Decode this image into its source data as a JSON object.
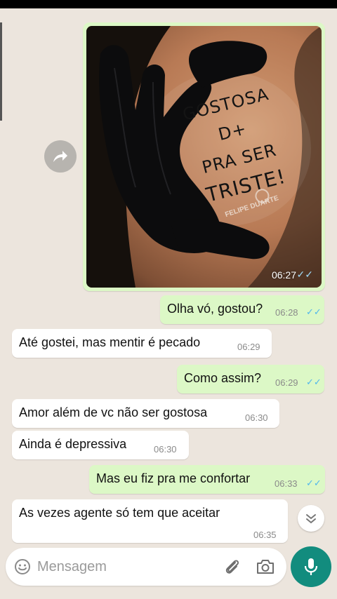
{
  "image_message": {
    "tattoo_text": [
      "GOSTOSA D+",
      "PRA SER",
      "TRISTE!"
    ],
    "watermark": "FELIPE DUARTE",
    "time": "06:27",
    "read_receipt": "double-check-read"
  },
  "messages": [
    {
      "direction": "out",
      "text": "Olha vó, gostou?",
      "time": "06:28"
    },
    {
      "direction": "in",
      "text": "Até gostei, mas mentir é pecado",
      "time": "06:29"
    },
    {
      "direction": "out",
      "text": "Como assim?",
      "time": "06:29"
    },
    {
      "direction": "in",
      "text": "Amor além de vc não ser gostosa",
      "time": "06:30"
    },
    {
      "direction": "in",
      "text": "Ainda é depressiva",
      "time": "06:30"
    },
    {
      "direction": "out",
      "text": "Mas eu fiz pra me confortar",
      "time": "06:33"
    },
    {
      "direction": "in",
      "text": "As vezes agente só tem que aceitar",
      "time": "06:35"
    }
  ],
  "input": {
    "placeholder": "Mensagem"
  },
  "icons": {
    "forward": "forward-icon",
    "emoji": "emoji-icon",
    "attach": "paperclip-icon",
    "camera": "camera-icon",
    "mic": "mic-icon",
    "scroll_down": "chevron-double-down-icon",
    "read": "double-check-icon"
  },
  "colors": {
    "outgoing_bubble": "#dcf8c6",
    "incoming_bubble": "#ffffff",
    "chat_background": "#ece5dd",
    "accent": "#128c7e",
    "read_check": "#4fb6ec"
  }
}
